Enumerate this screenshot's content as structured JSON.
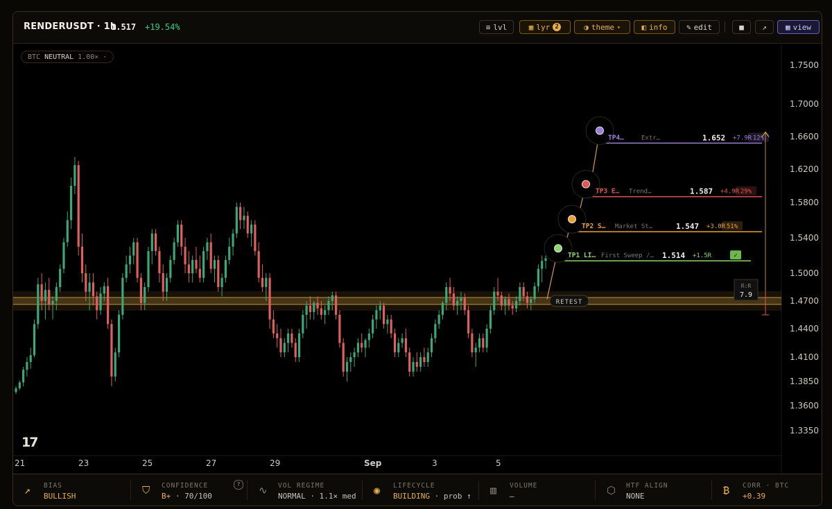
{
  "header": {
    "symbol": "RENDERUSDT · 1h",
    "price": "1.517",
    "change": "+19.54%",
    "buttons": {
      "lvl": "lvl",
      "lyr": "lyr",
      "lyr_badge": "2",
      "theme": "theme",
      "info": "info",
      "edit": "edit",
      "view": "view"
    },
    "icons": [
      "bars-icon",
      "grid-icon",
      "half-circle-icon",
      "panel-icon",
      "pencil-icon",
      "square-icon",
      "arrow-up-right-icon",
      "grid-icon"
    ]
  },
  "btc_pill": {
    "prefix": "BTC",
    "state": "NEUTRAL",
    "mult": "1.00×",
    "suffix": "·"
  },
  "chart_data": {
    "type": "candlestick",
    "symbol": "RENDERUSDT",
    "interval": "1h",
    "ylim": [
      1.31,
      1.78
    ],
    "y_ticks": [
      "1.7500",
      "1.7000",
      "1.6600",
      "1.6200",
      "1.5800",
      "1.5400",
      "1.5000",
      "1.4700",
      "1.4400",
      "1.4100",
      "1.3850",
      "1.3600",
      "1.3350"
    ],
    "x_ticks": [
      "21",
      "23",
      "25",
      "27",
      "29",
      "Sep",
      "3",
      "5"
    ],
    "colors": {
      "up": "#3aa97a",
      "down": "#e0605e",
      "level": "#e8b04a",
      "tp1": "#8fd46c",
      "tp2": "#e8a23a",
      "tp3": "#e05656",
      "tp4": "#9a7fd6"
    },
    "key_level": {
      "price": 1.47,
      "label": "RETEST"
    },
    "targets": [
      {
        "id": "TP1",
        "name": "TP1 LI…",
        "desc": "First Sweep /…",
        "price": "1.514",
        "r": "+1.5R",
        "prob": "✓"
      },
      {
        "id": "TP2",
        "name": "TP2 S…",
        "desc": "Market St…",
        "price": "1.547",
        "r": "+3.0R",
        "prob": "51%"
      },
      {
        "id": "TP3",
        "name": "TP3 E…",
        "desc": "Trend…",
        "price": "1.587",
        "r": "+4.9R",
        "prob": "29%"
      },
      {
        "id": "TP4",
        "name": "TP4…",
        "desc": "Extr…",
        "price": "1.652",
        "r": "+7.9R",
        "prob": "12%"
      }
    ],
    "rr": {
      "label": "R:R",
      "value": "7.9"
    },
    "candles": [
      [
        1.374,
        1.38,
        1.372,
        1.378
      ],
      [
        1.378,
        1.386,
        1.376,
        1.384
      ],
      [
        1.384,
        1.4,
        1.38,
        1.397
      ],
      [
        1.397,
        1.41,
        1.39,
        1.405
      ],
      [
        1.405,
        1.42,
        1.398,
        1.412
      ],
      [
        1.412,
        1.45,
        1.41,
        1.445
      ],
      [
        1.445,
        1.495,
        1.44,
        1.488
      ],
      [
        1.488,
        1.5,
        1.46,
        1.47
      ],
      [
        1.47,
        1.49,
        1.45,
        1.482
      ],
      [
        1.482,
        1.495,
        1.46,
        1.466
      ],
      [
        1.466,
        1.475,
        1.45,
        1.47
      ],
      [
        1.47,
        1.49,
        1.46,
        1.485
      ],
      [
        1.485,
        1.51,
        1.48,
        1.505
      ],
      [
        1.505,
        1.54,
        1.5,
        1.535
      ],
      [
        1.535,
        1.57,
        1.53,
        1.56
      ],
      [
        1.56,
        1.61,
        1.55,
        1.6
      ],
      [
        1.6,
        1.635,
        1.59,
        1.625
      ],
      [
        1.625,
        1.63,
        1.52,
        1.53
      ],
      [
        1.53,
        1.545,
        1.49,
        1.5
      ],
      [
        1.5,
        1.51,
        1.47,
        1.48
      ],
      [
        1.48,
        1.5,
        1.46,
        1.49
      ],
      [
        1.49,
        1.5,
        1.465,
        1.475
      ],
      [
        1.475,
        1.48,
        1.45,
        1.46
      ],
      [
        1.46,
        1.485,
        1.455,
        1.478
      ],
      [
        1.478,
        1.49,
        1.47,
        1.486
      ],
      [
        1.486,
        1.495,
        1.44,
        1.445
      ],
      [
        1.445,
        1.45,
        1.38,
        1.39
      ],
      [
        1.39,
        1.42,
        1.385,
        1.415
      ],
      [
        1.415,
        1.46,
        1.41,
        1.455
      ],
      [
        1.455,
        1.5,
        1.45,
        1.495
      ],
      [
        1.495,
        1.52,
        1.49,
        1.51
      ],
      [
        1.51,
        1.53,
        1.5,
        1.52
      ],
      [
        1.52,
        1.54,
        1.51,
        1.535
      ],
      [
        1.535,
        1.54,
        1.49,
        1.495
      ],
      [
        1.495,
        1.5,
        1.46,
        1.468
      ],
      [
        1.468,
        1.49,
        1.46,
        1.485
      ],
      [
        1.485,
        1.53,
        1.48,
        1.525
      ],
      [
        1.525,
        1.55,
        1.51,
        1.545
      ],
      [
        1.545,
        1.55,
        1.52,
        1.525
      ],
      [
        1.525,
        1.53,
        1.49,
        1.5
      ],
      [
        1.5,
        1.51,
        1.47,
        1.48
      ],
      [
        1.48,
        1.5,
        1.47,
        1.495
      ],
      [
        1.495,
        1.52,
        1.49,
        1.515
      ],
      [
        1.515,
        1.54,
        1.51,
        1.535
      ],
      [
        1.535,
        1.56,
        1.53,
        1.555
      ],
      [
        1.555,
        1.56,
        1.52,
        1.53
      ],
      [
        1.53,
        1.54,
        1.5,
        1.51
      ],
      [
        1.51,
        1.525,
        1.49,
        1.5
      ],
      [
        1.5,
        1.52,
        1.49,
        1.515
      ],
      [
        1.515,
        1.53,
        1.5,
        1.505
      ],
      [
        1.505,
        1.52,
        1.49,
        1.495
      ],
      [
        1.495,
        1.53,
        1.49,
        1.525
      ],
      [
        1.525,
        1.54,
        1.515,
        1.535
      ],
      [
        1.535,
        1.545,
        1.5,
        1.505
      ],
      [
        1.505,
        1.52,
        1.49,
        1.515
      ],
      [
        1.515,
        1.52,
        1.48,
        1.485
      ],
      [
        1.485,
        1.5,
        1.475,
        1.495
      ],
      [
        1.495,
        1.52,
        1.49,
        1.515
      ],
      [
        1.515,
        1.54,
        1.51,
        1.53
      ],
      [
        1.53,
        1.55,
        1.52,
        1.545
      ],
      [
        1.545,
        1.58,
        1.54,
        1.575
      ],
      [
        1.575,
        1.58,
        1.55,
        1.56
      ],
      [
        1.56,
        1.575,
        1.55,
        1.565
      ],
      [
        1.565,
        1.57,
        1.54,
        1.545
      ],
      [
        1.545,
        1.56,
        1.53,
        1.555
      ],
      [
        1.555,
        1.56,
        1.52,
        1.525
      ],
      [
        1.525,
        1.535,
        1.49,
        1.495
      ],
      [
        1.495,
        1.51,
        1.48,
        1.485
      ],
      [
        1.485,
        1.5,
        1.47,
        1.495
      ],
      [
        1.495,
        1.5,
        1.44,
        1.45
      ],
      [
        1.45,
        1.46,
        1.43,
        1.435
      ],
      [
        1.435,
        1.445,
        1.42,
        1.43
      ],
      [
        1.43,
        1.44,
        1.41,
        1.415
      ],
      [
        1.415,
        1.43,
        1.41,
        1.425
      ],
      [
        1.425,
        1.44,
        1.415,
        1.435
      ],
      [
        1.435,
        1.44,
        1.42,
        1.425
      ],
      [
        1.425,
        1.43,
        1.405,
        1.41
      ],
      [
        1.41,
        1.44,
        1.405,
        1.435
      ],
      [
        1.435,
        1.46,
        1.43,
        1.455
      ],
      [
        1.455,
        1.47,
        1.44,
        1.465
      ],
      [
        1.465,
        1.475,
        1.45,
        1.458
      ],
      [
        1.458,
        1.47,
        1.45,
        1.468
      ],
      [
        1.468,
        1.475,
        1.455,
        1.462
      ],
      [
        1.462,
        1.47,
        1.45,
        1.455
      ],
      [
        1.455,
        1.465,
        1.445,
        1.46
      ],
      [
        1.46,
        1.475,
        1.455,
        1.47
      ],
      [
        1.47,
        1.48,
        1.46,
        1.476
      ],
      [
        1.476,
        1.48,
        1.45,
        1.455
      ],
      [
        1.455,
        1.46,
        1.42,
        1.425
      ],
      [
        1.425,
        1.43,
        1.39,
        1.395
      ],
      [
        1.395,
        1.41,
        1.385,
        1.405
      ],
      [
        1.405,
        1.415,
        1.395,
        1.41
      ],
      [
        1.41,
        1.42,
        1.4,
        1.415
      ],
      [
        1.415,
        1.43,
        1.41,
        1.425
      ],
      [
        1.425,
        1.435,
        1.415,
        1.42
      ],
      [
        1.42,
        1.43,
        1.41,
        1.428
      ],
      [
        1.428,
        1.44,
        1.42,
        1.435
      ],
      [
        1.435,
        1.455,
        1.43,
        1.45
      ],
      [
        1.45,
        1.465,
        1.44,
        1.46
      ],
      [
        1.46,
        1.47,
        1.45,
        1.465
      ],
      [
        1.465,
        1.468,
        1.44,
        1.445
      ],
      [
        1.445,
        1.455,
        1.435,
        1.45
      ],
      [
        1.45,
        1.455,
        1.43,
        1.435
      ],
      [
        1.435,
        1.44,
        1.41,
        1.415
      ],
      [
        1.415,
        1.43,
        1.41,
        1.425
      ],
      [
        1.425,
        1.435,
        1.42,
        1.43
      ],
      [
        1.43,
        1.44,
        1.41,
        1.415
      ],
      [
        1.415,
        1.42,
        1.39,
        1.395
      ],
      [
        1.395,
        1.41,
        1.39,
        1.405
      ],
      [
        1.405,
        1.415,
        1.395,
        1.4
      ],
      [
        1.4,
        1.415,
        1.395,
        1.41
      ],
      [
        1.41,
        1.42,
        1.4,
        1.405
      ],
      [
        1.405,
        1.42,
        1.4,
        1.415
      ],
      [
        1.415,
        1.435,
        1.41,
        1.43
      ],
      [
        1.43,
        1.45,
        1.425,
        1.445
      ],
      [
        1.445,
        1.46,
        1.44,
        1.455
      ],
      [
        1.455,
        1.47,
        1.45,
        1.468
      ],
      [
        1.468,
        1.49,
        1.46,
        1.485
      ],
      [
        1.485,
        1.495,
        1.47,
        1.478
      ],
      [
        1.478,
        1.485,
        1.46,
        1.465
      ],
      [
        1.465,
        1.475,
        1.455,
        1.47
      ],
      [
        1.47,
        1.48,
        1.46,
        1.474
      ],
      [
        1.474,
        1.478,
        1.455,
        1.46
      ],
      [
        1.46,
        1.465,
        1.43,
        1.435
      ],
      [
        1.435,
        1.44,
        1.41,
        1.415
      ],
      [
        1.415,
        1.425,
        1.4,
        1.42
      ],
      [
        1.42,
        1.435,
        1.415,
        1.43
      ],
      [
        1.43,
        1.435,
        1.415,
        1.42
      ],
      [
        1.42,
        1.445,
        1.415,
        1.44
      ],
      [
        1.44,
        1.465,
        1.435,
        1.46
      ],
      [
        1.46,
        1.485,
        1.455,
        1.48
      ],
      [
        1.48,
        1.495,
        1.47,
        1.476
      ],
      [
        1.476,
        1.48,
        1.46,
        1.465
      ],
      [
        1.465,
        1.475,
        1.455,
        1.472
      ],
      [
        1.472,
        1.478,
        1.46,
        1.465
      ],
      [
        1.465,
        1.47,
        1.455,
        1.462
      ],
      [
        1.462,
        1.475,
        1.458,
        1.47
      ],
      [
        1.47,
        1.49,
        1.465,
        1.485
      ],
      [
        1.485,
        1.49,
        1.47,
        1.475
      ],
      [
        1.475,
        1.48,
        1.462,
        1.468
      ],
      [
        1.468,
        1.475,
        1.46,
        1.472
      ],
      [
        1.472,
        1.49,
        1.468,
        1.486
      ],
      [
        1.486,
        1.51,
        1.48,
        1.505
      ],
      [
        1.505,
        1.52,
        1.49,
        1.514
      ],
      [
        1.514,
        1.52,
        1.505,
        1.517
      ]
    ]
  },
  "status": [
    {
      "key": "bias",
      "icon": "trend-up-icon",
      "label": "BIAS",
      "value": "BULLISH",
      "value_hi": true
    },
    {
      "key": "confidence",
      "icon": "shield-icon",
      "label": "CONFIDENCE",
      "value": "B+",
      "value_rest": "· 70/100",
      "help": "?"
    },
    {
      "key": "vol",
      "icon": "wave-icon",
      "label": "VOL REGIME",
      "value": "NORMAL · 1.1× med"
    },
    {
      "key": "lifecycle",
      "icon": "target-icon",
      "label": "LIFECYCLE",
      "value": "BUILDING",
      "value_rest": "· prob ↑"
    },
    {
      "key": "volume",
      "icon": "bars-icon",
      "label": "VOLUME",
      "value": "–"
    },
    {
      "key": "htf",
      "icon": "hexagon-icon",
      "label": "HTF ALIGN",
      "value": "NONE"
    },
    {
      "key": "corr",
      "icon": "bitcoin-icon",
      "label": "CORR · BTC",
      "value": "+0.39",
      "value_hi": true
    }
  ]
}
